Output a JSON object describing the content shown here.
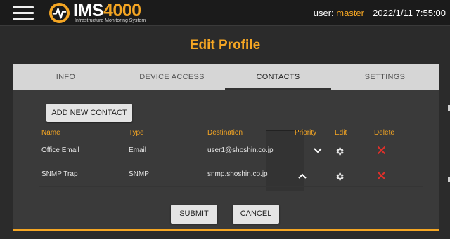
{
  "header": {
    "brand_prefix": "IMS",
    "brand_number": "4000",
    "brand_subtitle": "Infrastructure Monitoring System",
    "user_label": "user:",
    "username": "master",
    "datetime": "2022/1/11 7:55:00"
  },
  "page": {
    "title": "Edit Profile"
  },
  "tabs": [
    {
      "label": "INFO",
      "active": false
    },
    {
      "label": "DEVICE ACCESS",
      "active": false
    },
    {
      "label": "CONTACTS",
      "active": true
    },
    {
      "label": "SETTINGS",
      "active": false
    }
  ],
  "add_button": "ADD NEW CONTACT",
  "table": {
    "headers": [
      "Name",
      "Type",
      "Destination",
      "Priority",
      "Edit",
      "Delete"
    ],
    "rows": [
      {
        "name": "Office Email",
        "type": "Email",
        "destination": "user1@shoshin.co.jp",
        "priority_icon": "chevron-down-icon"
      },
      {
        "name": "SNMP Trap",
        "type": "SNMP",
        "destination": "snmp.shoshin.co.jp",
        "priority_icon": "chevron-up-icon"
      }
    ]
  },
  "actions": {
    "submit": "SUBMIT",
    "cancel": "CANCEL"
  },
  "colors": {
    "accent": "#f5a623",
    "delete": "#e0302b",
    "background": "#2b2b2b"
  }
}
